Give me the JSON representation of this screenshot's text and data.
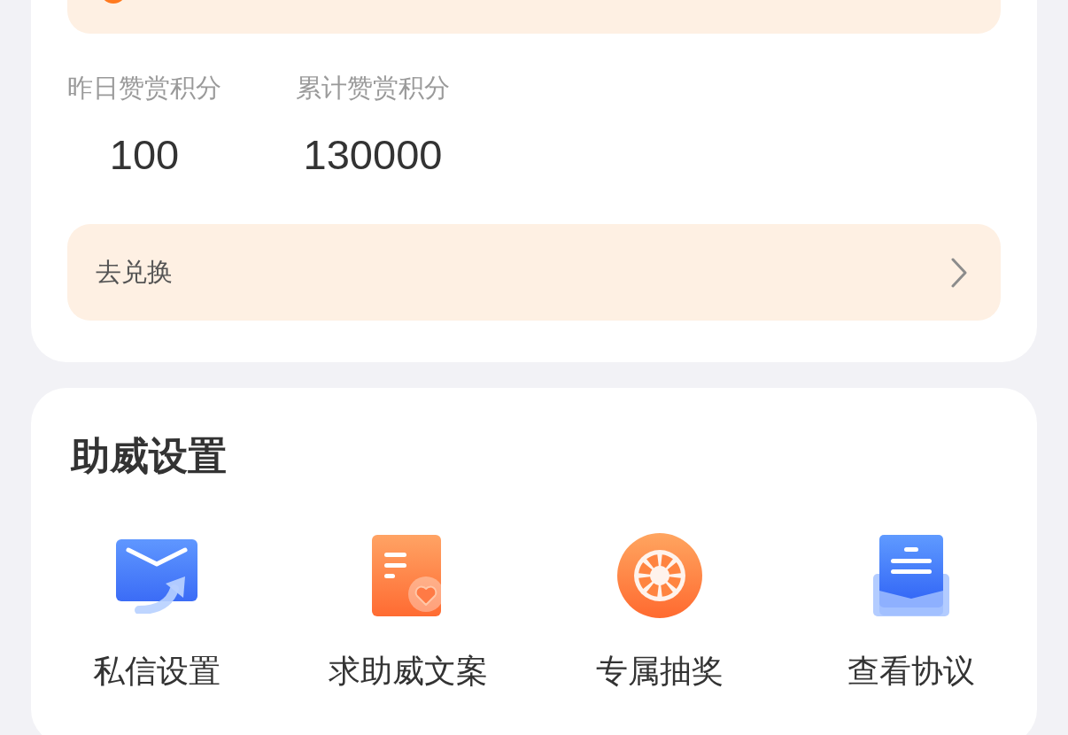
{
  "reward_card": {
    "stats": [
      {
        "label": "昨日赞赏积分",
        "value": "100"
      },
      {
        "label": "累计赞赏积分",
        "value": "130000"
      }
    ],
    "exchange_link": {
      "label": "去兑换"
    }
  },
  "support_settings": {
    "title": "助威设置",
    "items": [
      {
        "kind": "message",
        "label": "私信设置"
      },
      {
        "kind": "copywriting",
        "label": "求助威文案"
      },
      {
        "kind": "lottery",
        "label": "专属抽奖"
      },
      {
        "kind": "agreement",
        "label": "查看协议"
      }
    ]
  }
}
